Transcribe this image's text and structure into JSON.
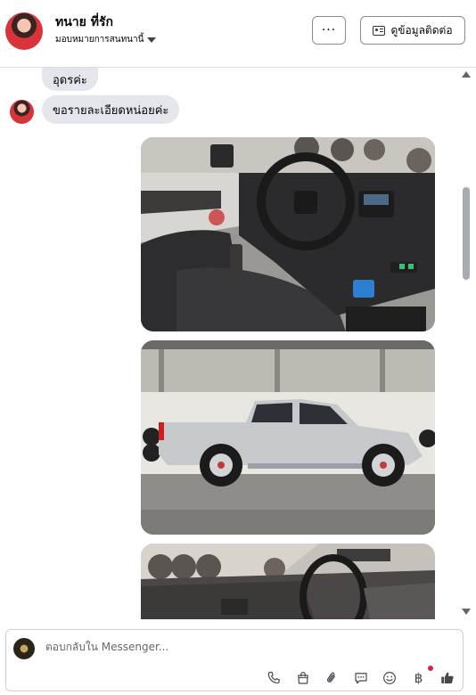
{
  "header": {
    "contact_name": "ทนาย ที่รัก",
    "assign_label": "มอบหมายการสนทนานี้",
    "more_label": "···",
    "view_info_label": "ดูข้อมูลติดต่อ"
  },
  "messages": [
    {
      "text": "อุดรค่ะ"
    },
    {
      "text": "ขอรายละเอียดหน่อยค่ะ"
    }
  ],
  "photos": [
    {
      "subject": "interior-dashboard"
    },
    {
      "subject": "silver-pickup-truck-side"
    },
    {
      "subject": "interior-dashboard-front"
    }
  ],
  "composer": {
    "placeholder": "ตอบกลับใน Messenger..."
  },
  "toolbar": {
    "icons": [
      "phone-icon",
      "shopping-bag-icon",
      "paperclip-icon",
      "chat-bubble-icon",
      "smiley-icon",
      "baht-icon",
      "thumbs-up-icon"
    ],
    "baht_symbol": "฿"
  },
  "colors": {
    "bubble": "#e4e6eb",
    "like_icon": "#444950",
    "notification_dot": "#e41e3f"
  }
}
